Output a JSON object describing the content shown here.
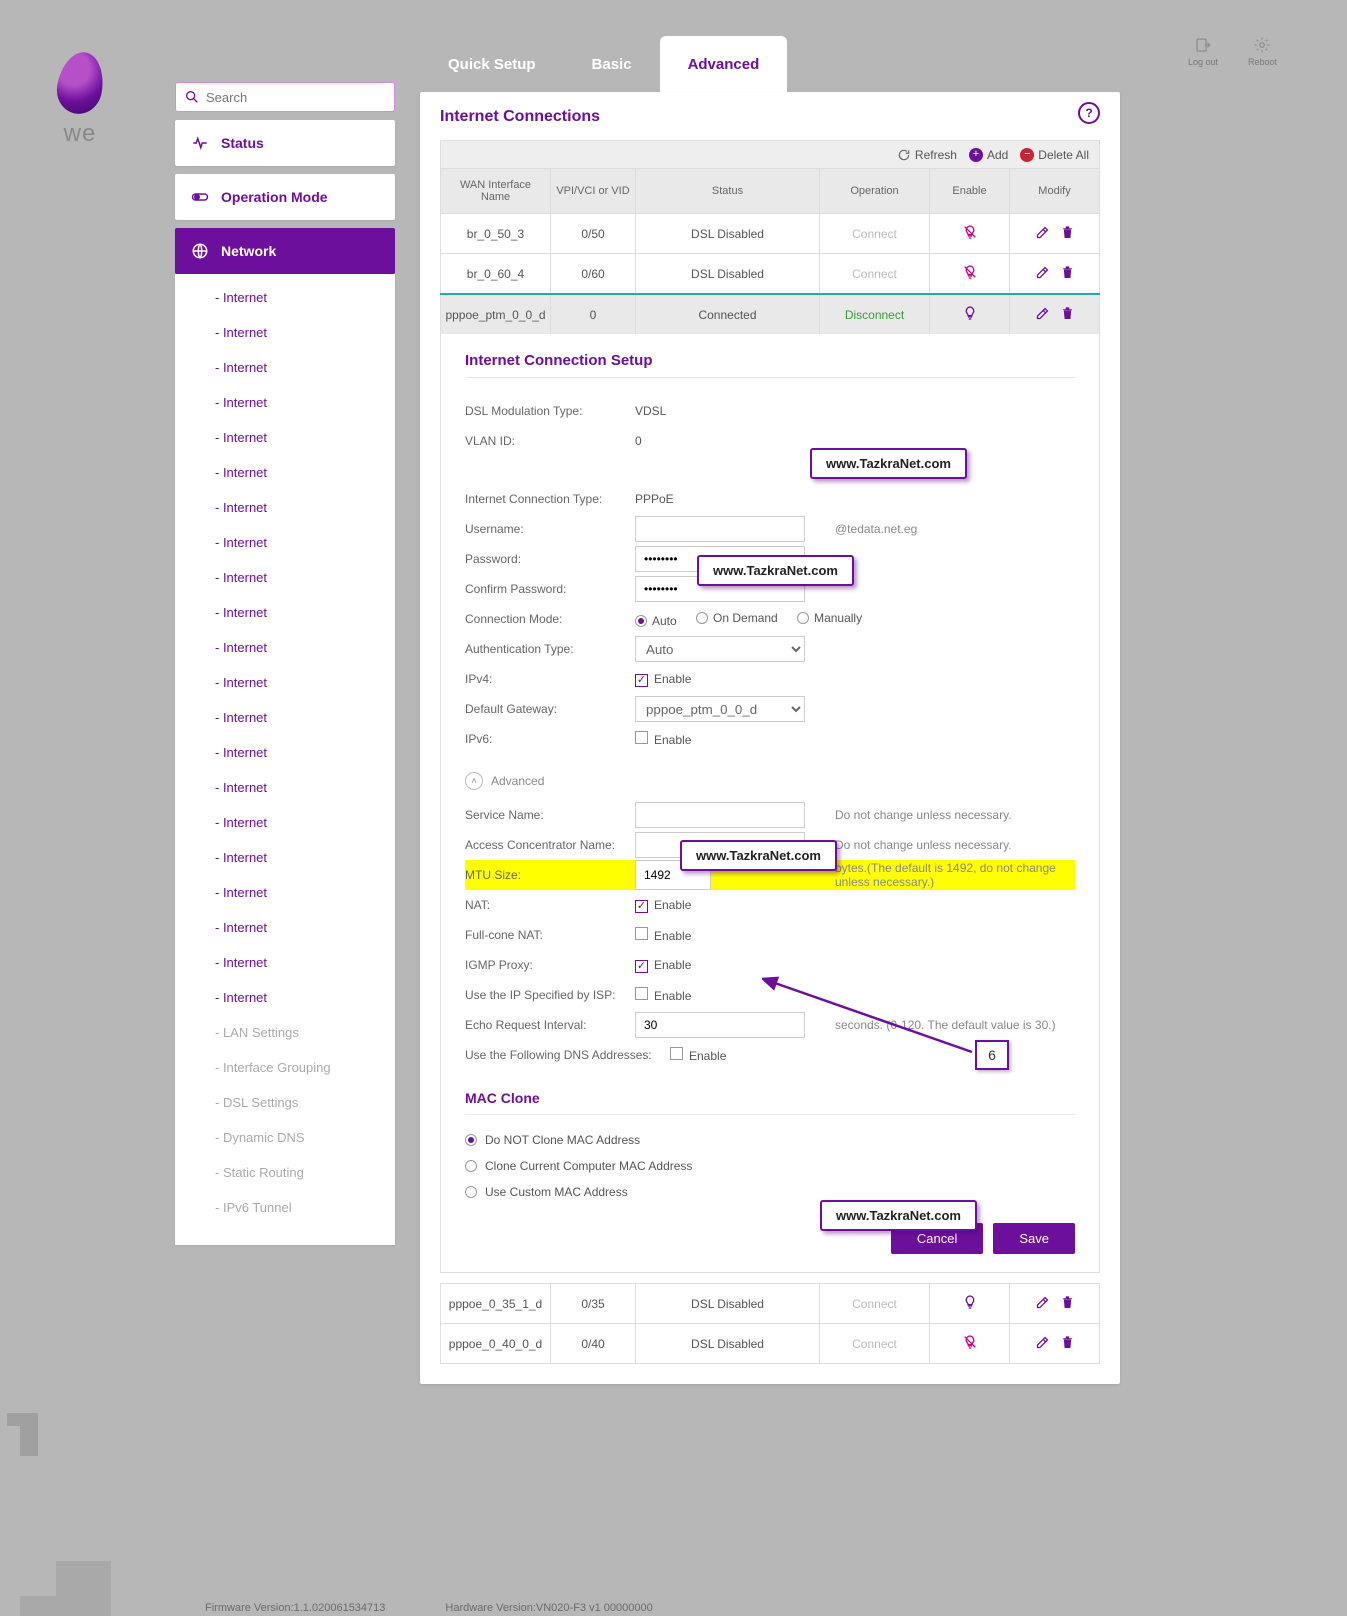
{
  "brand": "we",
  "header": {
    "logout": "Log out",
    "reboot": "Reboot"
  },
  "tabs": {
    "quick": "Quick Setup",
    "basic": "Basic",
    "advanced": "Advanced"
  },
  "search_placeholder": "Search",
  "sidebar": {
    "status": "Status",
    "opmode": "Operation Mode",
    "network": "Network",
    "internet_repeat": "- Internet",
    "items": [
      "- LAN Settings",
      "- Interface Grouping",
      "- DSL Settings",
      "- Dynamic DNS",
      "- Static Routing",
      "- IPv6 Tunnel"
    ]
  },
  "panel": {
    "title": "Internet Connections",
    "help": "?",
    "refresh": "Refresh",
    "add": "Add",
    "delete_all": "Delete All"
  },
  "columns": {
    "name": "WAN Interface Name",
    "vpi": "VPI/VCI or VID",
    "status": "Status",
    "operation": "Operation",
    "enable": "Enable",
    "modify": "Modify"
  },
  "rows": [
    {
      "name": "br_0_50_3",
      "vpi": "0/50",
      "status": "DSL Disabled",
      "op": "Connect",
      "enabled": false
    },
    {
      "name": "br_0_60_4",
      "vpi": "0/60",
      "status": "DSL Disabled",
      "op": "Connect",
      "enabled": false
    },
    {
      "name": "pppoe_ptm_0_0_d",
      "vpi": "0",
      "status": "Connected",
      "op": "Disconnect",
      "enabled": true,
      "selected": true
    }
  ],
  "rows_after": [
    {
      "name": "pppoe_0_35_1_d",
      "vpi": "0/35",
      "status": "DSL Disabled",
      "op": "Connect",
      "enabled": true
    },
    {
      "name": "pppoe_0_40_0_d",
      "vpi": "0/40",
      "status": "DSL Disabled",
      "op": "Connect",
      "enabled": false
    }
  ],
  "setup": {
    "title": "Internet Connection Setup",
    "dsl_mod_lbl": "DSL Modulation Type:",
    "dsl_mod": "VDSL",
    "vlan_lbl": "VLAN ID:",
    "vlan": "0",
    "conn_type_lbl": "Internet Connection Type:",
    "conn_type": "PPPoE",
    "user_lbl": "Username:",
    "user_suffix": "@tedata.net.eg",
    "pass_lbl": "Password:",
    "pass": "********",
    "cpass_lbl": "Confirm Password:",
    "cpass": "********",
    "cmode_lbl": "Connection Mode:",
    "cmode_auto": "Auto",
    "cmode_demand": "On Demand",
    "cmode_manual": "Manually",
    "auth_lbl": "Authentication Type:",
    "auth": "Auto",
    "ipv4_lbl": "IPv4:",
    "enable": "Enable",
    "gw_lbl": "Default Gateway:",
    "gw": "pppoe_ptm_0_0_d",
    "ipv6_lbl": "IPv6:",
    "adv": "Advanced",
    "svc_lbl": "Service Name:",
    "svc_hint": "Do not change unless necessary.",
    "acc_lbl": "Access Concentrator Name:",
    "acc_hint": "Do not change unless necessary.",
    "mtu_lbl": "MTU Size:",
    "mtu": "1492",
    "mtu_hint": "bytes.(The default is 1492, do not change unless necessary.)",
    "nat_lbl": "NAT:",
    "fcnat_lbl": "Full-cone NAT:",
    "igmp_lbl": "IGMP Proxy:",
    "ispip_lbl": "Use the IP Specified by ISP:",
    "echo_lbl": "Echo Request Interval:",
    "echo": "30",
    "echo_hint": "seconds. (0-120. The default value is 30.)",
    "usedns_lbl": "Use the Following DNS Addresses:"
  },
  "mac": {
    "title": "MAC Clone",
    "opt1": "Do NOT Clone MAC Address",
    "opt2": "Clone Current Computer MAC Address",
    "opt3": "Use Custom MAC Address"
  },
  "buttons": {
    "cancel": "Cancel",
    "save": "Save"
  },
  "watermark": "www.TazkraNet.com",
  "callout": "6",
  "footer": {
    "fw": "Firmware Version:1.1.020061534713",
    "hw": "Hardware Version:VN020-F3 v1 00000000"
  }
}
